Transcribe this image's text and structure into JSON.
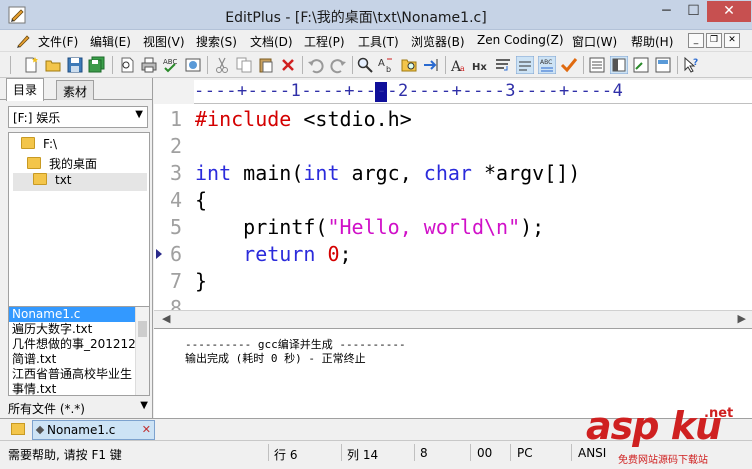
{
  "window": {
    "title": "EditPlus - [F:\\我的桌面\\txt\\Noname1.c]",
    "minimize": "─",
    "maximize": "☐",
    "close": "✕"
  },
  "menu": [
    "文件(F)",
    "编辑(E)",
    "视图(V)",
    "搜索(S)",
    "文档(D)",
    "工程(P)",
    "工具(T)",
    "浏览器(B)",
    "Zen Coding(Z)",
    "窗口(W)",
    "帮助(H)"
  ],
  "mdi": {
    "minimize": "_",
    "restore": "❐",
    "close": "✕"
  },
  "toolbar_icons": [
    "new-file-icon",
    "open-file-icon",
    "save-icon",
    "save-all-icon",
    "print-preview-icon",
    "print-icon",
    "spellcheck-icon",
    "browser-icon",
    "cut-icon",
    "copy-icon",
    "paste-icon",
    "delete-icon",
    "undo-icon",
    "redo-icon",
    "find-icon",
    "replace-icon",
    "find-in-files-icon",
    "goto-icon",
    "font-icon",
    "hex-icon",
    "word-wrap-icon",
    "ruler-icon",
    "line-number-icon",
    "spell-check-icon",
    "view-1-icon",
    "view-2-icon",
    "view-3-icon",
    "view-4-icon",
    "help-icon"
  ],
  "sidebar": {
    "tabs": [
      "目录",
      "素材"
    ],
    "drive": "[F:] 娱乐",
    "tree": [
      "F:\\",
      "我的桌面",
      "txt"
    ],
    "files": [
      "Noname1.c",
      "遍历大数字.txt",
      "几件想做的事_201212",
      "简谱.txt",
      "江西省普通高校毕业生",
      "事情.txt"
    ],
    "filter": "所有文件 (*.*)"
  },
  "ruler": "----+----1----+----2----+----3----+----4",
  "editor": {
    "line_numbers": [
      "1",
      "2",
      "3",
      "4",
      "5",
      "6",
      "7",
      "8"
    ],
    "lines": [
      "#include <stdio.h>",
      "",
      "int main(int argc, char *argv[])",
      "{",
      "    printf(\"Hello, world\\n\");",
      "    return 0;",
      "}",
      ""
    ],
    "tokens": {
      "l1_pp": "#include",
      "l1_rest": " <stdio.h>",
      "l3_int1": "int",
      "l3_a": " main(",
      "l3_int2": "int",
      "l3_b": " argc, ",
      "l3_char": "char",
      "l3_c": " *argv[])",
      "l4": "{",
      "l5_a": "    printf(",
      "l5_str": "\"Hello, world\\n\"",
      "l5_b": ");",
      "l6_a": "    ",
      "l6_kw": "return",
      "l6_sp": " ",
      "l6_num": "0",
      "l6_b": ";",
      "l7": "}"
    }
  },
  "output": [
    "---------- gcc编译并生成 ----------",
    "输出完成 (耗时 0 秒) - 正常终止"
  ],
  "doc_tab": {
    "label": "Noname1.c",
    "close": "✕"
  },
  "status": {
    "help": "需要帮助, 请按 F1 键",
    "row": "行 6",
    "col": "列 14",
    "tab": "8",
    "code": "00",
    "eol": "PC",
    "encoding": "ANSI"
  },
  "watermark": {
    "main": "asp ku",
    "net": ".net",
    "sub": "免费网站源码下载站"
  },
  "colors": {
    "keyword": "#2b2bdb",
    "preprocessor": "#d40000",
    "string": "#d010c8",
    "number": "#d40000",
    "selection": "#3399ff"
  }
}
